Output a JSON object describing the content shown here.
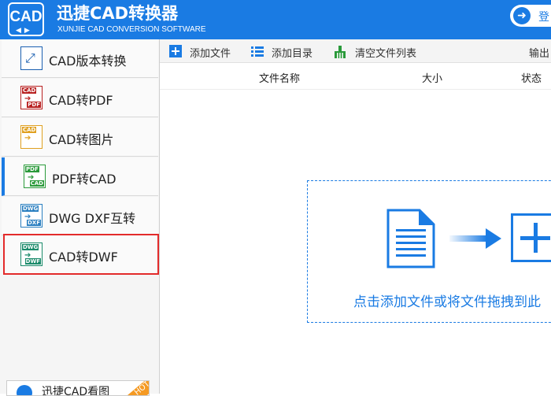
{
  "header": {
    "logo_text": "CAD",
    "title": "迅捷CAD转换器",
    "subtitle": "XUNJIE CAD CONVERSION SOFTWARE",
    "login_label": "登",
    "icons": {
      "login": "login-arrow-icon"
    }
  },
  "sidebar": {
    "items": [
      {
        "label": "CAD版本转换",
        "icon": "cad-version-icon",
        "tag": "",
        "tag2": "",
        "color": "#1a5fb0"
      },
      {
        "label": "CAD转PDF",
        "icon": "cad-to-pdf-icon",
        "tag": "CAD",
        "tag2": "PDF",
        "color": "#b82020"
      },
      {
        "label": "CAD转图片",
        "icon": "cad-to-image-icon",
        "tag": "CAD",
        "tag2": "",
        "color": "#e0a020"
      },
      {
        "label": "PDF转CAD",
        "icon": "pdf-to-cad-icon",
        "tag": "PDF",
        "tag2": "CAD",
        "color": "#2a9a3a"
      },
      {
        "label": "DWG DXF互转",
        "icon": "dwg-dxf-icon",
        "tag": "DWG",
        "tag2": "DXF",
        "color": "#2a7fc0"
      },
      {
        "label": "CAD转DWF",
        "icon": "cad-to-dwf-icon",
        "tag": "DWG",
        "tag2": "DWF",
        "color": "#1a8a6a"
      }
    ],
    "active_index": 3,
    "highlight_index": 5,
    "promo": {
      "label": "迅捷CAD看图",
      "badge": "HOT"
    }
  },
  "toolbar": {
    "add_file": "添加文件",
    "add_folder": "添加目录",
    "clear_list": "清空文件列表",
    "output": "输出"
  },
  "table": {
    "columns": [
      "文件名称",
      "大小",
      "状态"
    ]
  },
  "drop_zone": {
    "hint": "点击添加文件或将文件拖拽到此"
  },
  "colors": {
    "accent": "#1a7be3",
    "highlight": "#e32b2b",
    "badge": "#f59a23"
  }
}
